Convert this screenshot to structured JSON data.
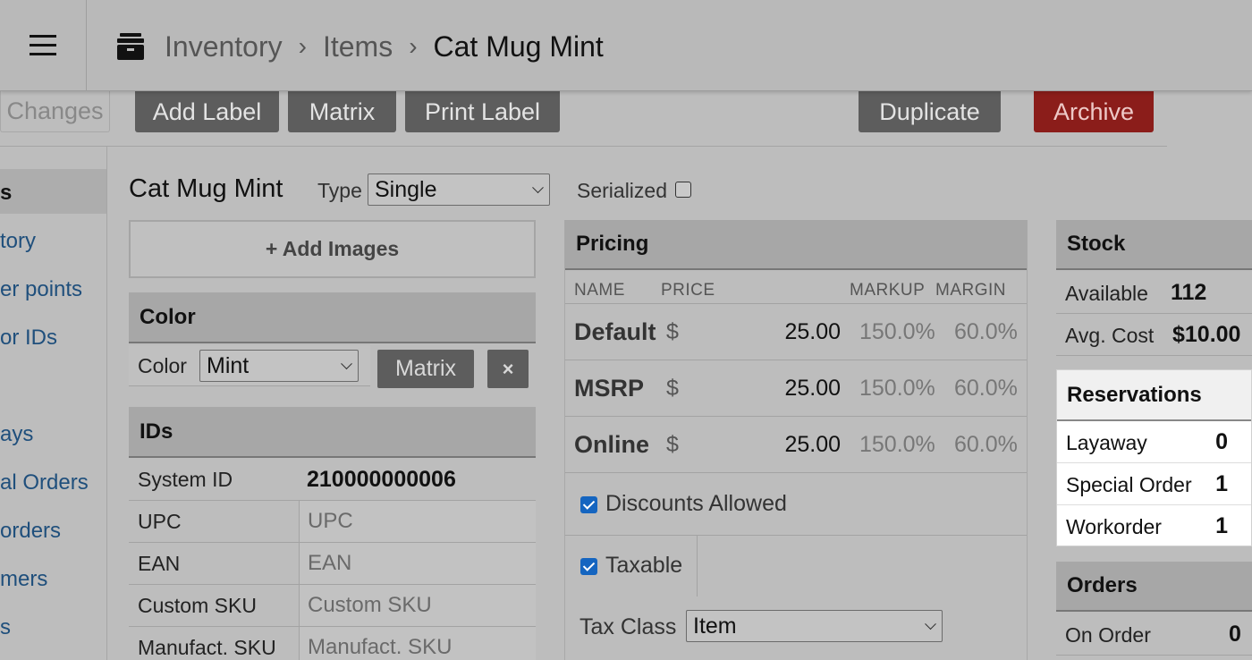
{
  "header": {
    "breadcrumb": [
      "Inventory",
      "Items",
      "Cat Mug Mint"
    ]
  },
  "actions": {
    "save_changes": "Changes",
    "add_label": "Add Label",
    "matrix": "Matrix",
    "print_label": "Print Label",
    "duplicate": "Duplicate",
    "archive": "Archive",
    "archive_color": "#8b1d1a"
  },
  "sidebar": {
    "items": [
      "s",
      "tory",
      "er points",
      "or IDs",
      "ays",
      "al Orders",
      "orders",
      "mers",
      "s"
    ]
  },
  "item": {
    "title": "Cat Mug Mint",
    "type_label": "Type",
    "type_value": "Single",
    "serialized_label": "Serialized",
    "add_images": "+ Add Images"
  },
  "color_panel": {
    "title": "Color",
    "label": "Color",
    "value": "Mint",
    "matrix_button": "Matrix",
    "remove_button": "×"
  },
  "ids_panel": {
    "title": "IDs",
    "rows": [
      {
        "label": "System ID",
        "value": "210000000006"
      },
      {
        "label": "UPC",
        "value": "UPC"
      },
      {
        "label": "EAN",
        "value": "EAN"
      },
      {
        "label": "Custom SKU",
        "value": "Custom SKU"
      },
      {
        "label": "Manufact. SKU",
        "value": "Manufact. SKU"
      }
    ]
  },
  "pricing": {
    "title": "Pricing",
    "columns": [
      "NAME",
      "PRICE",
      "MARKUP",
      "MARGIN"
    ],
    "rows": [
      {
        "name": "Default",
        "currency": "$",
        "price": "25.00",
        "markup": "150.0%",
        "margin": "60.0%"
      },
      {
        "name": "MSRP",
        "currency": "$",
        "price": "25.00",
        "markup": "150.0%",
        "margin": "60.0%"
      },
      {
        "name": "Online",
        "currency": "$",
        "price": "25.00",
        "markup": "150.0%",
        "margin": "60.0%"
      }
    ],
    "discounts_label": "Discounts Allowed",
    "taxable_label": "Taxable",
    "tax_class_label": "Tax Class",
    "tax_class_value": "Item",
    "checkbox_color": "#1565c0"
  },
  "stock": {
    "title": "Stock",
    "available_label": "Available",
    "available_value": "112",
    "avg_cost_label": "Avg. Cost",
    "avg_cost_value": "$10.00"
  },
  "reservations": {
    "title": "Reservations",
    "rows": [
      {
        "label": "Layaway",
        "value": "0"
      },
      {
        "label": "Special Order",
        "value": "1"
      },
      {
        "label": "Workorder",
        "value": "1"
      }
    ]
  },
  "orders": {
    "title": "Orders",
    "on_order_label": "On Order",
    "on_order_value": "0"
  }
}
